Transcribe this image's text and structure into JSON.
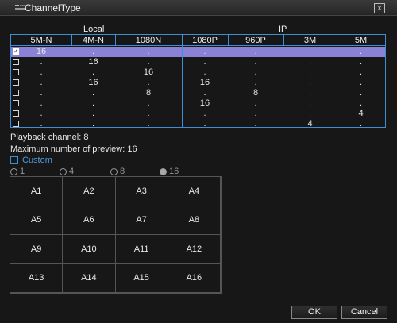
{
  "window": {
    "title": "ChannelType",
    "close_label": "x"
  },
  "groups": {
    "local": "Local",
    "ip": "IP"
  },
  "columns": [
    "5M-N",
    "4M-N",
    "1080N",
    "1080P",
    "960P",
    "3M",
    "5M"
  ],
  "rows": [
    {
      "checked": true,
      "cells": [
        "16",
        ".",
        ".",
        ".",
        ".",
        ".",
        "."
      ]
    },
    {
      "checked": false,
      "cells": [
        ".",
        "16",
        ".",
        ".",
        ".",
        ".",
        "."
      ]
    },
    {
      "checked": false,
      "cells": [
        ".",
        ".",
        "16",
        ".",
        ".",
        ".",
        "."
      ]
    },
    {
      "checked": false,
      "cells": [
        ".",
        "16",
        ".",
        "16",
        ".",
        ".",
        "."
      ]
    },
    {
      "checked": false,
      "cells": [
        ".",
        ".",
        "8",
        ".",
        "8",
        ".",
        "."
      ]
    },
    {
      "checked": false,
      "cells": [
        ".",
        ".",
        ".",
        "16",
        ".",
        ".",
        "."
      ]
    },
    {
      "checked": false,
      "cells": [
        ".",
        ".",
        ".",
        ".",
        ".",
        ".",
        "4"
      ]
    },
    {
      "checked": false,
      "cells": [
        ".",
        ".",
        ".",
        ".",
        ".",
        "4",
        "."
      ]
    }
  ],
  "info": {
    "playback": "Playback channel: 8",
    "max_preview": "Maximum number of preview: 16",
    "custom_label": "Custom"
  },
  "preview_options": [
    {
      "label": "1",
      "selected": false
    },
    {
      "label": "4",
      "selected": false
    },
    {
      "label": "8",
      "selected": false
    },
    {
      "label": "16",
      "selected": true
    }
  ],
  "grid_cells": [
    "A1",
    "A2",
    "A3",
    "A4",
    "A5",
    "A6",
    "A7",
    "A8",
    "A9",
    "A10",
    "A11",
    "A12",
    "A13",
    "A14",
    "A15",
    "A16"
  ],
  "buttons": {
    "ok": "OK",
    "cancel": "Cancel"
  },
  "colors": {
    "accent": "#3d8fd6",
    "selected_row": "#8a82d6",
    "background": "#171717"
  }
}
